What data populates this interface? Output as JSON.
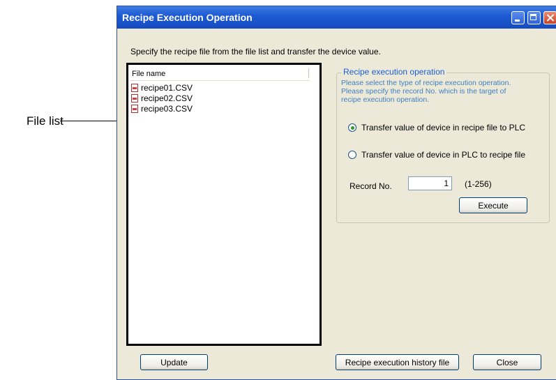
{
  "callout": {
    "label": "File list"
  },
  "window": {
    "title": "Recipe Execution Operation",
    "instruction": "Specify the recipe file from the file list and transfer the device value."
  },
  "file_list": {
    "header": "File name",
    "files": [
      "recipe01.CSV",
      "recipe02.CSV",
      "recipe03.CSV"
    ]
  },
  "operation_group": {
    "title": "Recipe execution operation",
    "description_line1": "Please select the type of recipe execution operation.",
    "description_line2": "Please specify the record No. which is the target of",
    "description_line3": "recipe execution operation.",
    "option_to_plc": "Transfer value of device in recipe file to PLC",
    "option_to_file": "Transfer value of device in PLC to recipe file",
    "selected_option": "option_to_plc",
    "record_label": "Record No.",
    "record_value": "1",
    "record_range": "(1-256)",
    "execute_label": "Execute"
  },
  "buttons": {
    "update": "Update",
    "history": "Recipe execution history file",
    "close": "Close"
  },
  "colors": {
    "titlebar": "#1e5bd4",
    "window_bg": "#ece9d8",
    "group_title": "#1a5fd6",
    "group_desc": "#3f7fc0"
  }
}
